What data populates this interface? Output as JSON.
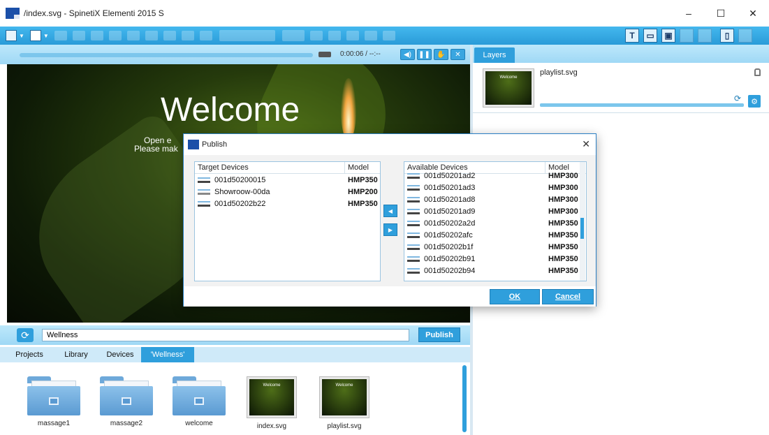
{
  "window": {
    "title": "/index.svg - SpinetiX Elementi 2015 S",
    "minimize": "–",
    "maximize": "☐",
    "close": "✕"
  },
  "preview": {
    "time": "0:00:06 / --:--",
    "welcome_title": "Welcome",
    "welcome_sub1": "Open e",
    "welcome_sub2": "Please mak"
  },
  "layers": {
    "tab_label": "Layers",
    "item_name": "playlist.svg",
    "thumb_text": "Welcome"
  },
  "library": {
    "search_value": "Wellness",
    "publish_label": "Publish",
    "tabs": [
      "Projects",
      "Library",
      "Devices",
      "'Wellness'"
    ],
    "items": [
      {
        "label": "massage1",
        "type": "folder"
      },
      {
        "label": "massage2",
        "type": "folder"
      },
      {
        "label": "welcome",
        "type": "folder"
      },
      {
        "label": "index.svg",
        "type": "svg"
      },
      {
        "label": "playlist.svg",
        "type": "svg"
      }
    ],
    "thumb_text": "Welcome"
  },
  "dialog": {
    "title": "Publish",
    "close": "✕",
    "target": {
      "header_name": "Target Devices",
      "header_model": "Model",
      "rows": [
        {
          "name": "001d50200015",
          "model": "HMP350"
        },
        {
          "name": "Showroow-00da",
          "model": "HMP200"
        },
        {
          "name": "001d50202b22",
          "model": "HMP350"
        }
      ]
    },
    "available": {
      "header_name": "Available Devices",
      "header_model": "Model",
      "rows": [
        {
          "name": "001d50201ad2",
          "model": "HMP300"
        },
        {
          "name": "001d50201ad3",
          "model": "HMP300"
        },
        {
          "name": "001d50201ad8",
          "model": "HMP300"
        },
        {
          "name": "001d50201ad9",
          "model": "HMP300"
        },
        {
          "name": "001d50202a2d",
          "model": "HMP350"
        },
        {
          "name": "001d50202afc",
          "model": "HMP350"
        },
        {
          "name": "001d50202b1f",
          "model": "HMP350"
        },
        {
          "name": "001d50202b91",
          "model": "HMP350"
        },
        {
          "name": "001d50202b94",
          "model": "HMP350"
        }
      ]
    },
    "move_left": "◀",
    "move_right": "▶",
    "ok_label": "OK",
    "cancel_label": "Cancel"
  },
  "colors": {
    "accent": "#2f9fdc",
    "toolbar": "#36a9e4",
    "panel": "#bde8fb"
  }
}
